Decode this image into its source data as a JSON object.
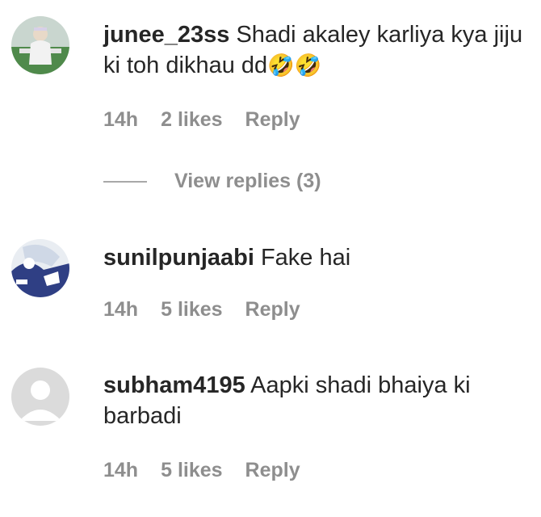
{
  "comments": [
    {
      "username": "junee_23ss",
      "text": "Shadi akaley karliya kya jiju ki toh dikhau dd",
      "emoji": "🤣🤣",
      "time": "14h",
      "likes": "2 likes",
      "reply": "Reply",
      "view_replies": "View replies (3)"
    },
    {
      "username": "sunilpunjaabi",
      "text": "Fake hai",
      "time": "14h",
      "likes": "5 likes",
      "reply": "Reply"
    },
    {
      "username": "subham4195",
      "text": "Aapki shadi bhaiya ki barbadi",
      "time": "14h",
      "likes": "5 likes",
      "reply": "Reply"
    }
  ]
}
